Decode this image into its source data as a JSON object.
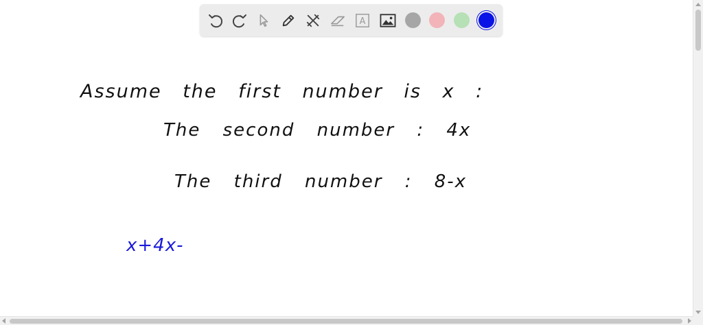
{
  "toolbar": {
    "tools": [
      "undo-icon",
      "redo-icon",
      "pointer-icon",
      "pen-icon",
      "tools-icon",
      "eraser-icon",
      "text-icon",
      "image-icon"
    ],
    "text_tool_label": "A",
    "colors": [
      "#a6a6a6",
      "#f2b3b9",
      "#b6e0b6",
      "#0a14e6"
    ],
    "selected_color": "#0a14e6"
  },
  "canvas": {
    "line1": "Assume the first number is x :",
    "line2": "The second number : 4x",
    "line3": "The third number : 8-x",
    "line4": "x+4x-",
    "ink_black": "#111111",
    "ink_blue": "#1a1adb"
  }
}
